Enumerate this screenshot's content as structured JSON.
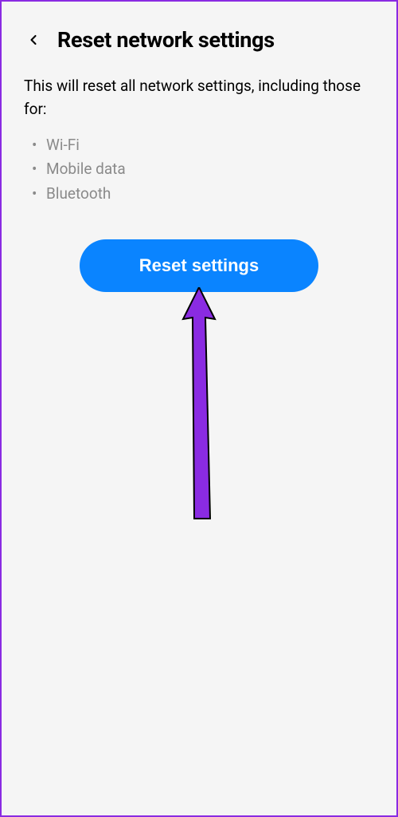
{
  "header": {
    "title": "Reset network settings"
  },
  "description": "This will reset all network settings, including those for:",
  "bullets": {
    "item0": "Wi-Fi",
    "item1": "Mobile data",
    "item2": "Bluetooth"
  },
  "button": {
    "label": "Reset settings"
  },
  "colors": {
    "accent": "#0a84ff",
    "annotation": "#8a2be2"
  }
}
